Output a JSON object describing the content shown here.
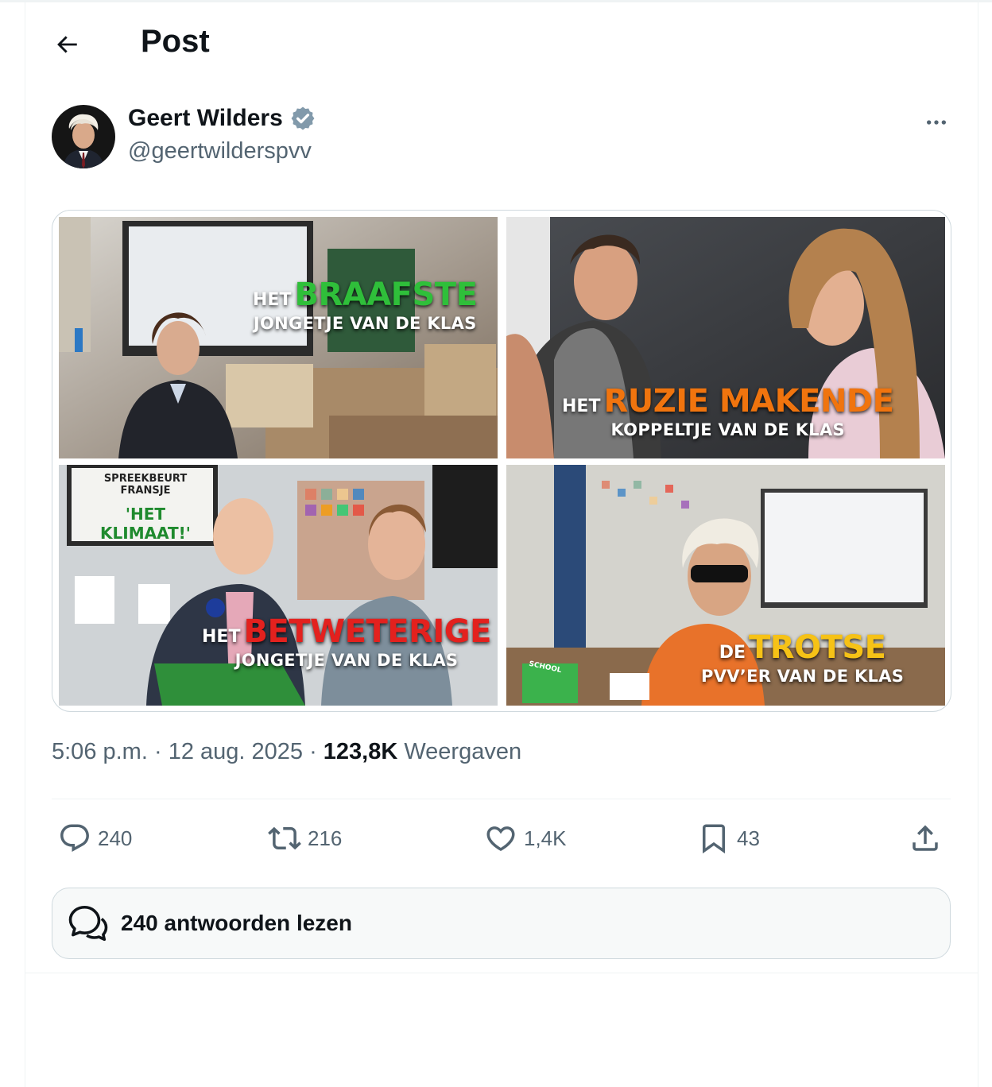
{
  "header": {
    "title": "Post"
  },
  "author": {
    "name": "Geert Wilders",
    "handle": "@geertwilderspvv",
    "verified": true
  },
  "media": {
    "tiles": [
      {
        "prefix": "HET",
        "highlight": "BRAAFSTE",
        "subtitle": "JONGETJE VAN DE KLAS",
        "accent": "#2fbf3a"
      },
      {
        "prefix": "HET",
        "highlight": "RUZIE MAKENDE",
        "subtitle": "KOPPELTJE VAN DE KLAS",
        "accent": "#f0740e"
      },
      {
        "prefix": "HET",
        "highlight": "BETWETERIGE",
        "subtitle": "JONGETJE VAN DE KLAS",
        "accent": "#e3211e",
        "screen_line1": "SPREEKBEURT FRANSJE",
        "screen_line2": "'HET KLIMAAT!'"
      },
      {
        "prefix": "DE",
        "highlight": "TROTSE",
        "subtitle": "PVV’ER VAN DE KLAS",
        "accent": "#f6c216",
        "notebook_label": "SCHOOL"
      }
    ]
  },
  "meta": {
    "time": "5:06 p.m.",
    "sep1": " · ",
    "date": "12 aug. 2025",
    "sep2": " · ",
    "views_count": "123,8K",
    "views_label": "Weergaven"
  },
  "actions": {
    "replies": "240",
    "reposts": "216",
    "likes": "1,4K",
    "bookmarks": "43"
  },
  "read_replies": {
    "label": "240 antwoorden lezen"
  },
  "icons": [
    "back-arrow-icon",
    "verified-badge-icon",
    "more-icon",
    "reply-icon",
    "repost-icon",
    "like-icon",
    "bookmark-icon",
    "share-icon",
    "replies-bubble-icon"
  ],
  "colors": {
    "text": "#0f1419",
    "secondary": "#536471",
    "border": "#cfd9de",
    "verified": "#829aab"
  }
}
